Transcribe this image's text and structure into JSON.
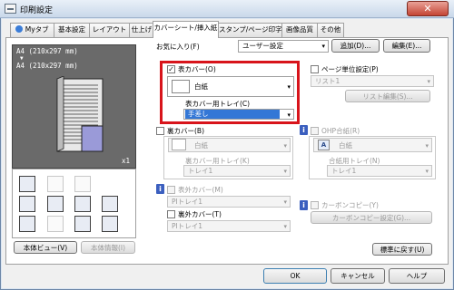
{
  "window": {
    "title": "印刷設定",
    "close_glyph": "✕"
  },
  "tabs": [
    {
      "label": "Myタブ",
      "active": false
    },
    {
      "label": "基本設定",
      "active": false
    },
    {
      "label": "レイアウト",
      "active": false
    },
    {
      "label": "仕上げ",
      "active": false
    },
    {
      "label": "カバーシート/挿入紙",
      "active": true
    },
    {
      "label": "スタンプ/ページ印字",
      "active": false
    },
    {
      "label": "画像品質",
      "active": false
    },
    {
      "label": "その他",
      "active": false
    }
  ],
  "favorites": {
    "label": "お気に入り(F)",
    "value": "ユーザー設定",
    "add_label": "追加(D)...",
    "edit_label": "編集(E)..."
  },
  "preview": {
    "line1": "A4 (210x297 mm)",
    "arrow": "▼",
    "line2": "A4 (210x297 mm)",
    "copies": "x1"
  },
  "left_buttons": {
    "view": "本体ビュー(V)",
    "info": "本体情報(I)"
  },
  "front_cover": {
    "checkbox_label": "表カバー(O)",
    "checked": true,
    "paper_value": "白紙",
    "tray_label": "表カバー用トレイ(C)",
    "tray_value": "手差し"
  },
  "back_cover": {
    "checkbox_label": "裏カバー(B)",
    "checked": false,
    "paper_value": "白紙",
    "tray_label": "裏カバー用トレイ(K)",
    "tray_value": "トレイ1"
  },
  "front_outer": {
    "checkbox_label": "表外カバー(M)",
    "value": "PIトレイ1"
  },
  "back_outer": {
    "checkbox_label": "裏外カバー(T)",
    "value": "PIトレイ1"
  },
  "per_page": {
    "checkbox_label": "ページ単位設定(P)",
    "list_value": "リスト1",
    "edit_label": "リスト編集(S)..."
  },
  "ohp": {
    "checkbox_label": "OHP合紙(R)",
    "paper_value": "白紙",
    "tray_label": "合紙用トレイ(N)",
    "tray_value": "トレイ1"
  },
  "carbon": {
    "checkbox_label": "カーボンコピー(Y)",
    "settings_label": "カーボンコピー設定(G)..."
  },
  "restore_label": "標準に戻す(U)",
  "footer": {
    "ok": "OK",
    "cancel": "キャンセル",
    "help": "ヘルプ"
  },
  "info_glyph": "i",
  "check_glyph": "✓",
  "dropdown_glyph": "▾"
}
